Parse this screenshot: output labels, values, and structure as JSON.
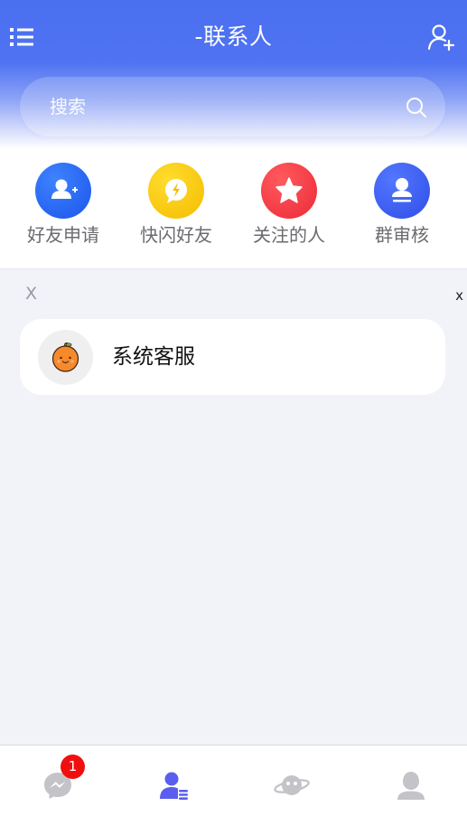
{
  "header": {
    "title": "-联系人",
    "menu_icon": "list-icon",
    "add_icon": "add-contact-icon"
  },
  "search": {
    "placeholder": "搜索",
    "icon": "search-icon"
  },
  "quick_actions": [
    {
      "label": "好友申请",
      "icon": "friend-request-icon",
      "color": "#2a63f3"
    },
    {
      "label": "快闪好友",
      "icon": "flash-friend-icon",
      "color": "#f7c400"
    },
    {
      "label": "关注的人",
      "icon": "star-icon",
      "color": "#f23c45"
    },
    {
      "label": "群审核",
      "icon": "group-review-icon",
      "color": "#3f5ff0"
    }
  ],
  "contacts": {
    "section_letter": "X",
    "index_letter": "x",
    "items": [
      {
        "name": "系统客服",
        "avatar": "orange-avatar-icon"
      }
    ]
  },
  "bottom_nav": {
    "items": [
      {
        "icon": "messenger-icon",
        "badge": "1",
        "active": false
      },
      {
        "icon": "contacts-icon",
        "active": true
      },
      {
        "icon": "planet-icon",
        "active": false
      },
      {
        "icon": "profile-icon",
        "active": false
      }
    ],
    "active_color": "#5a5ef0",
    "inactive_color": "#c6c6c9"
  }
}
